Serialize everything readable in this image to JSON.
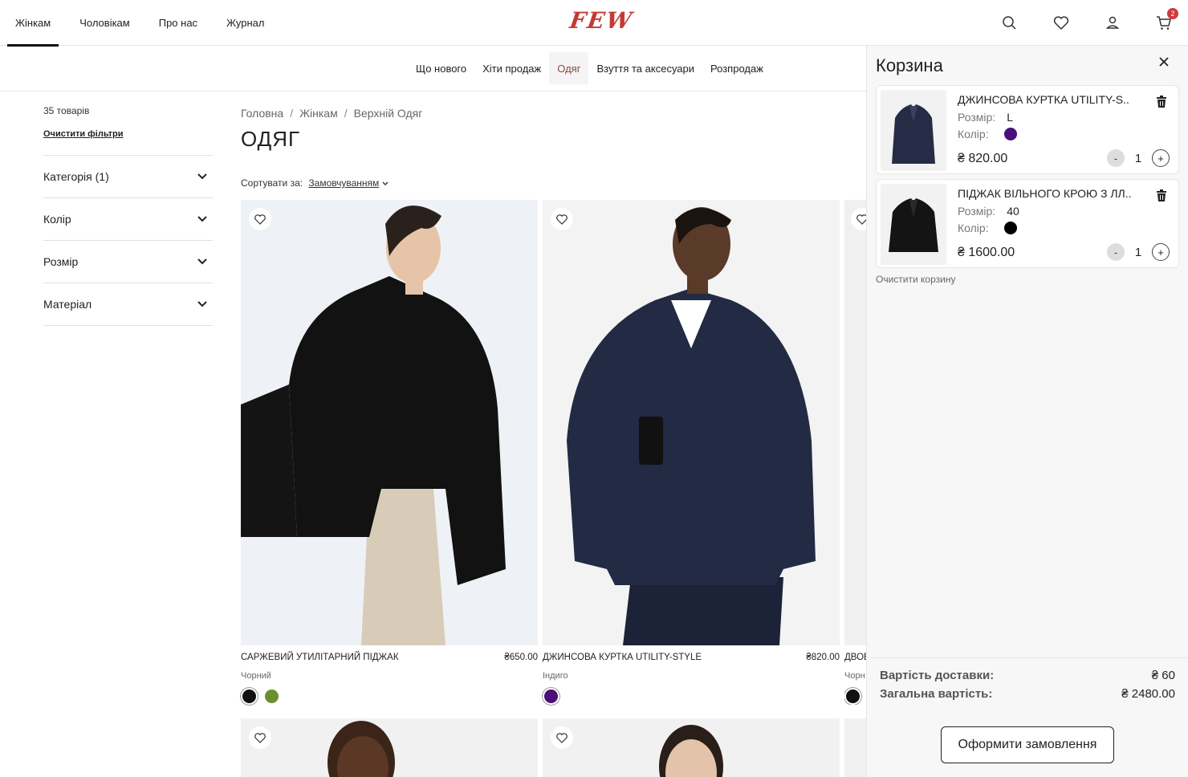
{
  "header": {
    "nav": [
      "Жінкам",
      "Чоловікам",
      "Про нас",
      "Журнал"
    ],
    "active_index": 0,
    "logo": "FEW",
    "cart_count": "2",
    "icons": [
      "search-icon",
      "heart-icon",
      "user-icon",
      "cart-icon"
    ]
  },
  "subnav": {
    "items": [
      "Що нового",
      "Хіти продаж",
      "Одяг",
      "Взуття та аксесуари",
      "Розпродаж"
    ],
    "active_index": 2
  },
  "sidebar": {
    "count": "35 товарів",
    "clear_filters": "Очистити фільтри",
    "filters": [
      "Категорія (1)",
      "Колір",
      "Розмір",
      "Матеріал"
    ]
  },
  "main": {
    "breadcrumb": [
      "Головна",
      "Жінкам",
      "Верхній Одяг"
    ],
    "title": "ОДЯГ",
    "sort_label": "Сортувати за:",
    "sort_value": "Замовчуванням"
  },
  "products": [
    {
      "name": "САРЖЕВИЙ УТИЛІТАРНИЙ ПІДЖАК",
      "price": "₴650.00",
      "color": "Чорний",
      "swatches": [
        "#111111",
        "#6b8e2f"
      ]
    },
    {
      "name": "ДЖИНСОВА КУРТКА UTILITY-STYLE",
      "price": "₴820.00",
      "color": "Індиго",
      "swatches": [
        "#4b0f7a"
      ]
    },
    {
      "name": "ДВОБ",
      "price": "",
      "color": "Чорн",
      "swatches": [
        "#111111"
      ]
    }
  ],
  "cart": {
    "title": "Корзина",
    "size_label": "Розмір:",
    "color_label": "Колір:",
    "items": [
      {
        "name": "ДЖИНСОВА КУРТКА UTILITY-S..",
        "size": "L",
        "color": "#4b0f7a",
        "price": "₴ 820.00",
        "qty": "1"
      },
      {
        "name": "ПІДЖАК ВІЛЬНОГО КРОЮ З ЛЛ..",
        "size": "40",
        "color": "#000000",
        "price": "₴ 1600.00",
        "qty": "1"
      }
    ],
    "clear": "Очистити корзину",
    "delivery_label": "Вартість доставки:",
    "delivery_value": "₴ 60",
    "total_label": "Загальна вартість:",
    "total_value": "₴ 2480.00",
    "checkout": "Оформити замовлення",
    "minus": "-",
    "plus": "+"
  }
}
